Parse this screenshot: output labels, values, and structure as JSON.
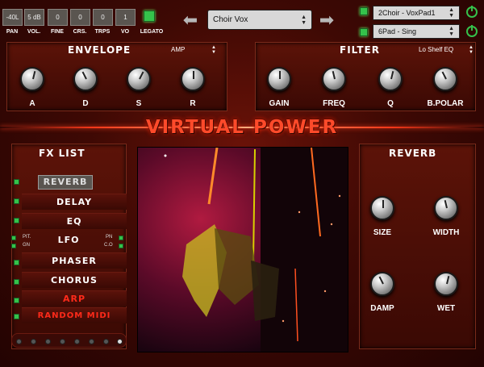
{
  "top_params": [
    {
      "value": "-40L",
      "label": "PAN"
    },
    {
      "value": "5 dB",
      "label": "VOL."
    },
    {
      "value": "0",
      "label": "FINE"
    },
    {
      "value": "0",
      "label": "CRS."
    },
    {
      "value": "0",
      "label": "TRPS"
    },
    {
      "value": "1",
      "label": "VO"
    }
  ],
  "legato": {
    "label": "LEGATO"
  },
  "preset": {
    "value": "Choir Vox",
    "prev_icon": "arrow-left-icon",
    "next_icon": "arrow-right-icon"
  },
  "layers": [
    {
      "value": "2Choir - VoxPad1",
      "power_icon": "power-icon"
    },
    {
      "value": "6Pad - Sing",
      "power_icon": "power-icon"
    }
  ],
  "envelope": {
    "title": "ENVELOPE",
    "mode": "AMP",
    "knobs": [
      {
        "label": "A",
        "value": 0.55
      },
      {
        "label": "D",
        "value": 0.4
      },
      {
        "label": "S",
        "value": 0.6
      },
      {
        "label": "R",
        "value": 0.5
      }
    ]
  },
  "filter": {
    "title": "FILTER",
    "type": "Lo Shelf EQ",
    "knobs": [
      {
        "label": "GAIN",
        "value": 0.5
      },
      {
        "label": "FREQ",
        "value": 0.45
      },
      {
        "label": "Q",
        "value": 0.55
      },
      {
        "label": "B.POLAR",
        "value": 0.4
      }
    ]
  },
  "banner": {
    "title": "VIRTUAL POWER"
  },
  "fx_list": {
    "title": "FX LIST",
    "items": [
      {
        "label": "REVERB",
        "active": true
      },
      {
        "label": "DELAY",
        "active": false
      },
      {
        "label": "EQ",
        "active": false
      },
      {
        "label": "LFO",
        "active": false
      },
      {
        "label": "PHASER",
        "active": false
      },
      {
        "label": "CHORUS",
        "active": false
      },
      {
        "label": "ARP",
        "active": false
      },
      {
        "label": "RANDOM MIDI",
        "active": false
      }
    ],
    "lfo_targets": {
      "pit": "PIT.",
      "gn": "GN",
      "pn": "PN",
      "co": "C.O"
    }
  },
  "reverb": {
    "title": "REVERB",
    "knobs": [
      {
        "label": "SIZE",
        "value": 0.5
      },
      {
        "label": "WIDTH",
        "value": 0.45
      },
      {
        "label": "DAMP",
        "value": 0.4
      },
      {
        "label": "WET",
        "value": 0.55
      }
    ]
  },
  "colors": {
    "accent": "#ff3a1a",
    "led_on": "#35c24b",
    "panel_bg": "#4a0d06"
  }
}
